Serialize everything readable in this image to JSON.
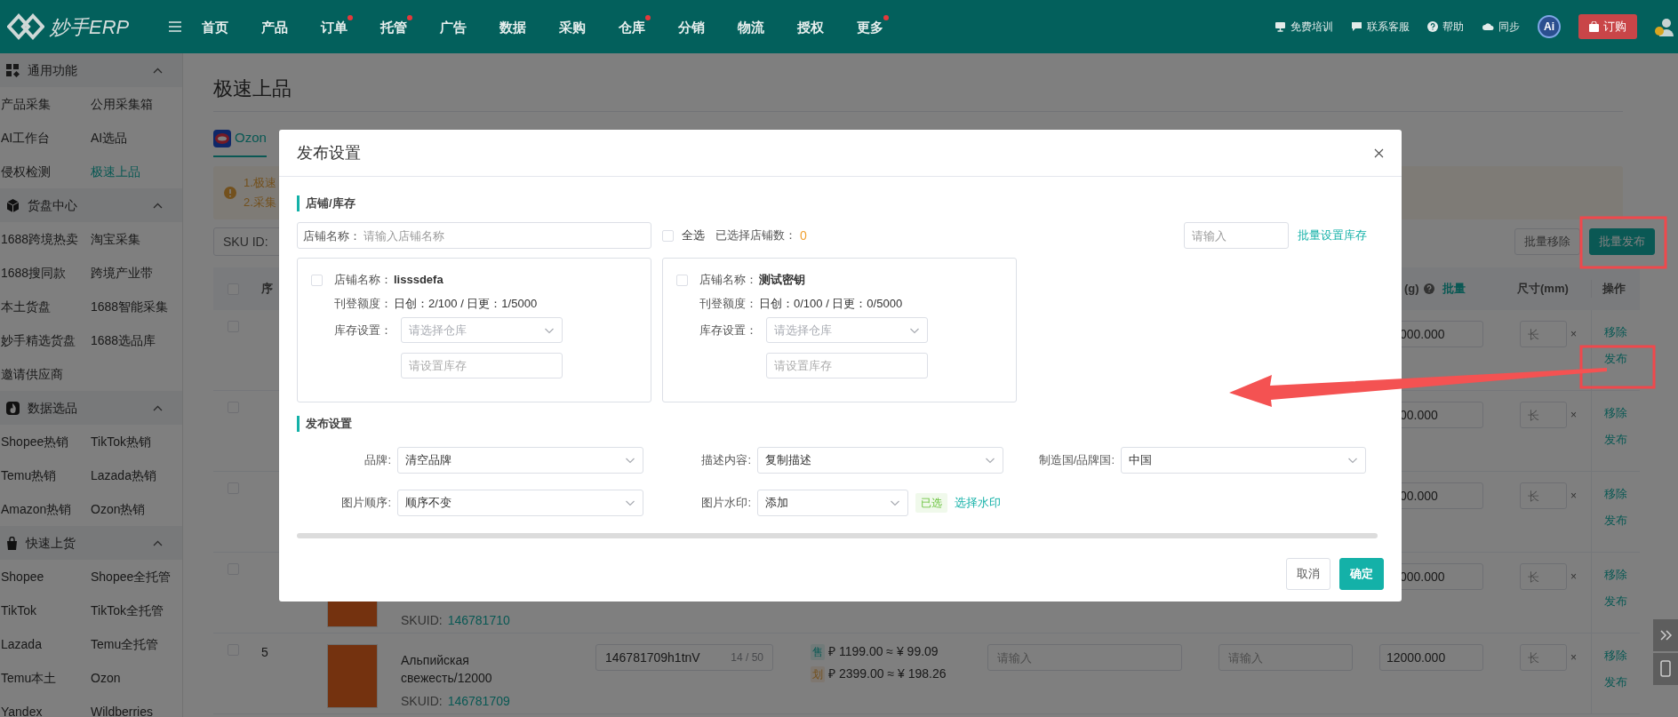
{
  "header": {
    "logo": "妙手ERP",
    "nav": [
      {
        "label": "首页",
        "dot": false
      },
      {
        "label": "产品",
        "dot": false
      },
      {
        "label": "订单",
        "dot": true
      },
      {
        "label": "托管",
        "dot": true
      },
      {
        "label": "广告",
        "dot": false
      },
      {
        "label": "数据",
        "dot": false
      },
      {
        "label": "采购",
        "dot": false
      },
      {
        "label": "仓库",
        "dot": true
      },
      {
        "label": "分销",
        "dot": false
      },
      {
        "label": "物流",
        "dot": false
      },
      {
        "label": "授权",
        "dot": false
      },
      {
        "label": "更多",
        "dot": true
      }
    ],
    "tools": [
      {
        "kind": "training",
        "label": "免费培训"
      },
      {
        "kind": "service",
        "label": "联系客服"
      },
      {
        "kind": "help",
        "label": "帮助"
      },
      {
        "kind": "sync",
        "label": "同步"
      }
    ],
    "ai": "Ai",
    "order_button": "订购"
  },
  "sidebar": [
    {
      "kind": "grid",
      "title": "通用功能",
      "expanded": true,
      "items": [
        {
          "label": "产品采集",
          "selected": false
        },
        {
          "label": "公用采集箱",
          "selected": false
        },
        {
          "label": "AI工作台",
          "selected": false
        },
        {
          "label": "AI选品",
          "selected": false
        },
        {
          "label": "侵权检测",
          "selected": false
        },
        {
          "label": "极速上品",
          "selected": true
        }
      ]
    },
    {
      "kind": "cube",
      "title": "货盘中心",
      "expanded": true,
      "items": [
        {
          "label": "1688跨境热卖",
          "selected": false
        },
        {
          "label": "淘宝采集",
          "selected": false
        },
        {
          "label": "1688搜同款",
          "selected": false
        },
        {
          "label": "跨境产业带",
          "selected": false
        },
        {
          "label": "本土货盘",
          "selected": false
        },
        {
          "label": "1688智能采集",
          "selected": false
        },
        {
          "label": "妙手精选货盘",
          "selected": false
        },
        {
          "label": "1688选品库",
          "selected": false
        },
        {
          "label": "邀请供应商",
          "selected": false
        }
      ]
    },
    {
      "kind": "fire",
      "title": "数据选品",
      "expanded": true,
      "items": [
        {
          "label": "Shopee热销",
          "selected": false
        },
        {
          "label": "TikTok热销",
          "selected": false
        },
        {
          "label": "Temu热销",
          "selected": false
        },
        {
          "label": "Lazada热销",
          "selected": false
        },
        {
          "label": "Amazon热销",
          "selected": false
        },
        {
          "label": "Ozon热销",
          "selected": false
        }
      ]
    },
    {
      "kind": "bag",
      "title": "快速上货",
      "expanded": true,
      "items": [
        {
          "label": "Shopee",
          "selected": false
        },
        {
          "label": "Shopee全托管",
          "selected": false
        },
        {
          "label": "TikTok",
          "selected": false
        },
        {
          "label": "TikTok全托管",
          "selected": false
        },
        {
          "label": "Lazada",
          "selected": false
        },
        {
          "label": "Temu全托管",
          "selected": false
        },
        {
          "label": "Temu本土",
          "selected": false
        },
        {
          "label": "Ozon",
          "selected": false
        },
        {
          "label": "Yandex",
          "selected": false
        },
        {
          "label": "Wildberries",
          "selected": false
        }
      ]
    }
  ],
  "page": {
    "title": "极速上品",
    "tabs": [
      {
        "label": "Ozon",
        "selected": true
      }
    ],
    "notice": [
      "1.极速",
      "2.采集"
    ],
    "filter_label": "SKU ID:",
    "actions": [
      {
        "label": "批量移除",
        "kind": "plain"
      },
      {
        "label": "批量发布",
        "kind": "primary"
      }
    ]
  },
  "table": {
    "header": {
      "checked": false,
      "seq": "序",
      "weight": "(g)",
      "weight_link": "批量",
      "size": "尺寸(mm)",
      "actions": "操作"
    },
    "rows": [
      {
        "kind": "covered",
        "checked": false,
        "weight": "000.000",
        "size_placeholder": "长",
        "times": "×",
        "actions": [
          "移除",
          "发布"
        ]
      },
      {
        "kind": "covered",
        "checked": false,
        "weight": "00.000",
        "size_placeholder": "长",
        "times": "×",
        "actions": [
          "移除",
          "发布"
        ]
      },
      {
        "kind": "covered",
        "checked": false,
        "weight": "00.000",
        "size_placeholder": "长",
        "times": "×",
        "actions": [
          "移除",
          "发布"
        ]
      },
      {
        "kind": "covered",
        "checked": false,
        "product": {
          "sku_label": "SKUID:",
          "sku_id": "146781710"
        },
        "weight": "000.000",
        "size_placeholder": "长",
        "times": "×",
        "actions": [
          "移除",
          "发布"
        ]
      },
      {
        "kind": "full",
        "checked": false,
        "seq": "5",
        "product": {
          "name": "Альпийская свежесть/12000",
          "sku_label": "SKUID:",
          "sku_id": "146781709"
        },
        "sku_code": "146781709h1tnV",
        "sku_count": "14 / 50",
        "prices": [
          {
            "kind": "sale",
            "tag": "售",
            "text": "₽ 1199.00 ≈ ¥ 99.09"
          },
          {
            "kind": "list",
            "tag": "划",
            "text": "₽ 2399.00 ≈ ¥ 198.26"
          }
        ],
        "input_1_placeholder": "请输入",
        "input_2_placeholder": "请输入",
        "weight": "12000.000",
        "size_placeholder": "长",
        "times": "×",
        "actions": [
          "移除",
          "发布"
        ]
      }
    ]
  },
  "modal": {
    "title": "发布设置",
    "store_section": {
      "title": "店铺/库存",
      "search_label": "店铺名称：",
      "search_placeholder": "请输入店铺名称",
      "select_all": {
        "label": "全选",
        "checked": false
      },
      "selected_count_label": "已选择店铺数：",
      "selected_count": "0",
      "batch_placeholder": "请输入",
      "batch_link": "批量设置库存",
      "stores": [
        {
          "checked": false,
          "name_label": "店铺名称：",
          "name": "lisssdefa",
          "quota_label": "刊登额度：",
          "quota": "日创：2/100 / 日更：1/5000",
          "stock_label": "库存设置：",
          "warehouse_placeholder": "请选择仓库",
          "stock_placeholder": "请设置库存"
        },
        {
          "checked": false,
          "name_label": "店铺名称：",
          "name": "测试密钥",
          "quota_label": "刊登额度：",
          "quota": "日创：0/100 / 日更：0/5000",
          "stock_label": "库存设置：",
          "warehouse_placeholder": "请选择仓库",
          "stock_placeholder": "请设置库存"
        }
      ]
    },
    "publish_section": {
      "title": "发布设置",
      "fields": [
        {
          "label": "品牌:",
          "value": "清空品牌"
        },
        {
          "label": "描述内容:",
          "value": "复制描述"
        },
        {
          "label": "制造国/品牌国:",
          "value": "中国"
        },
        {
          "label": "图片顺序:",
          "value": "顺序不变"
        },
        {
          "label": "图片水印:",
          "value": "添加",
          "tag": "已选",
          "link": "选择水印"
        }
      ]
    },
    "buttons": [
      {
        "label": "取消",
        "kind": "secondary"
      },
      {
        "label": "确定",
        "kind": "primary"
      }
    ]
  }
}
